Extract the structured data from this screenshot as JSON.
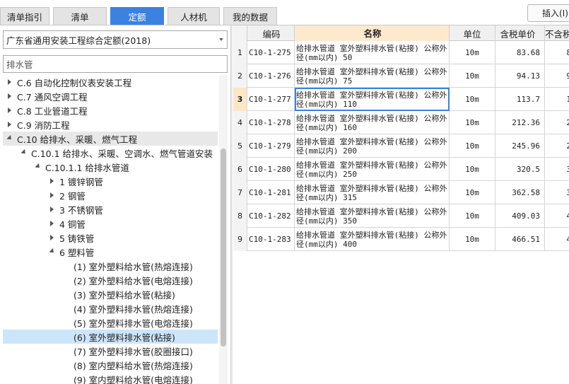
{
  "tabs": [
    {
      "label": "清单指引",
      "active": false
    },
    {
      "label": "清单",
      "active": false
    },
    {
      "label": "定额",
      "active": true
    },
    {
      "label": "人材机",
      "active": false
    },
    {
      "label": "我的数据",
      "active": false
    }
  ],
  "insert_label": "插入(I)",
  "library_select": "广东省通用安装工程综合定额(2018)",
  "search_value": "排水管",
  "tree": [
    {
      "label": "C.6 自动化控制仪表安装工程",
      "indent": 0,
      "arrow": "right"
    },
    {
      "label": "C.7 通风空调工程",
      "indent": 0,
      "arrow": "right"
    },
    {
      "label": "C.8 工业管道工程",
      "indent": 0,
      "arrow": "right"
    },
    {
      "label": "C.9 消防工程",
      "indent": 0,
      "arrow": "right"
    },
    {
      "label": "C.10 给排水、采暖、燃气工程",
      "indent": 0,
      "arrow": "down",
      "highlight": true
    },
    {
      "label": "C.10.1 给排水、采暖、空调水、燃气管道安装",
      "indent": 1,
      "arrow": "down"
    },
    {
      "label": "C.10.1.1 给排水管道",
      "indent": 2,
      "arrow": "down"
    },
    {
      "label": "1 镀锌钢管",
      "indent": 3,
      "arrow": "right"
    },
    {
      "label": "2 钢管",
      "indent": 3,
      "arrow": "right"
    },
    {
      "label": "3 不锈钢管",
      "indent": 3,
      "arrow": "right"
    },
    {
      "label": "4 铜管",
      "indent": 3,
      "arrow": "right"
    },
    {
      "label": "5 铸铁管",
      "indent": 3,
      "arrow": "right"
    },
    {
      "label": "6 塑料管",
      "indent": 3,
      "arrow": "down"
    },
    {
      "label": "(1) 室外塑料给水管(热熔连接)",
      "indent": 4,
      "arrow": "none"
    },
    {
      "label": "(2) 室外塑料给水管(电熔连接)",
      "indent": 4,
      "arrow": "none"
    },
    {
      "label": "(3) 室外塑料给水管(粘接)",
      "indent": 4,
      "arrow": "none"
    },
    {
      "label": "(4) 室外塑料排水管(热熔连接)",
      "indent": 4,
      "arrow": "none"
    },
    {
      "label": "(5) 室外塑料排水管(电熔连接)",
      "indent": 4,
      "arrow": "none"
    },
    {
      "label": "(6) 室外塑料排水管(粘接)",
      "indent": 4,
      "arrow": "none",
      "selected": true
    },
    {
      "label": "(7) 室外塑料排水管(胶圈接口)",
      "indent": 4,
      "arrow": "none"
    },
    {
      "label": "(8) 室内塑料给水管(热熔连接)",
      "indent": 4,
      "arrow": "none"
    },
    {
      "label": "(9) 室内塑料给水管(电熔连接)",
      "indent": 4,
      "arrow": "none"
    }
  ],
  "grid": {
    "headers": {
      "index": "",
      "code": "编码",
      "name": "名称",
      "unit": "单位",
      "price": "含税单价",
      "extra": "不含税"
    },
    "rows": [
      {
        "idx": "1",
        "code": "C10-1-275",
        "name": "给排水管道 室外塑料排水管(粘接) 公称外径(mm以内) 50",
        "unit": "10m",
        "price": "83.68",
        "extra": "8"
      },
      {
        "idx": "2",
        "code": "C10-1-276",
        "name": "给排水管道 室外塑料排水管(粘接) 公称外径(mm以内) 75",
        "unit": "10m",
        "price": "94.13",
        "extra": "9"
      },
      {
        "idx": "3",
        "code": "C10-1-277",
        "name": "给排水管道 室外塑料排水管(粘接) 公称外径(mm以内) 110",
        "unit": "10m",
        "price": "113.7",
        "extra": "1",
        "current": true
      },
      {
        "idx": "4",
        "code": "C10-1-278",
        "name": "给排水管道 室外塑料排水管(粘接) 公称外径(mm以内) 160",
        "unit": "10m",
        "price": "212.36",
        "extra": "2"
      },
      {
        "idx": "5",
        "code": "C10-1-279",
        "name": "给排水管道 室外塑料排水管(粘接) 公称外径(mm以内) 200",
        "unit": "10m",
        "price": "245.96",
        "extra": "2"
      },
      {
        "idx": "6",
        "code": "C10-1-280",
        "name": "给排水管道 室外塑料排水管(粘接) 公称外径(mm以内) 250",
        "unit": "10m",
        "price": "320.5",
        "extra": "3"
      },
      {
        "idx": "7",
        "code": "C10-1-281",
        "name": "给排水管道 室外塑料排水管(粘接) 公称外径(mm以内) 315",
        "unit": "10m",
        "price": "362.58",
        "extra": "3"
      },
      {
        "idx": "8",
        "code": "C10-1-282",
        "name": "给排水管道 室外塑料排水管(粘接) 公称外径(mm以内) 350",
        "unit": "10m",
        "price": "409.03",
        "extra": "4"
      },
      {
        "idx": "9",
        "code": "C10-1-283",
        "name": "给排水管道 室外塑料排水管(粘接) 公称外径(mm以内) 400",
        "unit": "10m",
        "price": "466.51",
        "extra": "4"
      }
    ]
  }
}
